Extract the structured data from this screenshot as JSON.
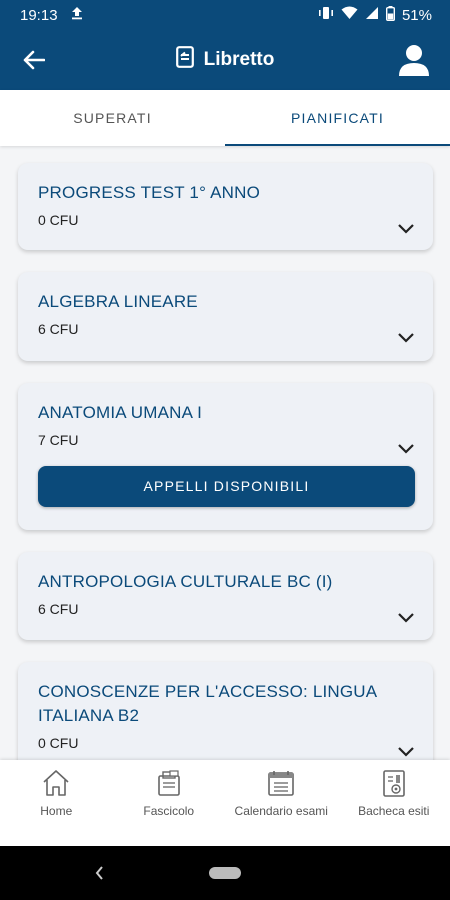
{
  "status_bar": {
    "time": "19:13",
    "battery": "51%"
  },
  "app_bar": {
    "title": "Libretto"
  },
  "tabs": [
    {
      "label": "SUPERATI",
      "active": false
    },
    {
      "label": "PIANIFICATI",
      "active": true
    }
  ],
  "courses": [
    {
      "title": "PROGRESS TEST 1° ANNO",
      "cfu": "0 CFU"
    },
    {
      "title": "ALGEBRA LINEARE",
      "cfu": "6 CFU"
    },
    {
      "title": "ANATOMIA UMANA I",
      "cfu": "7 CFU",
      "button": "APPELLI DISPONIBILI"
    },
    {
      "title": "ANTROPOLOGIA CULTURALE BC (I)",
      "cfu": "6 CFU"
    },
    {
      "title": "CONOSCENZE PER L'ACCESSO: LINGUA ITALIANA B2",
      "cfu": "0 CFU"
    }
  ],
  "bottom_nav": [
    {
      "label": "Home",
      "icon": "home-icon"
    },
    {
      "label": "Fascicolo",
      "icon": "folder-icon"
    },
    {
      "label": "Calendario esami",
      "icon": "calendar-icon"
    },
    {
      "label": "Bacheca esiti",
      "icon": "results-board-icon"
    }
  ],
  "colors": {
    "primary": "#0b4a7a",
    "card_bg": "#eef1f6"
  }
}
